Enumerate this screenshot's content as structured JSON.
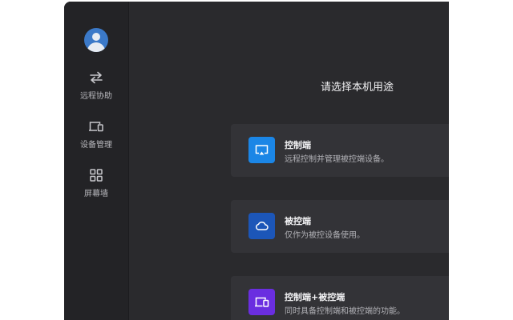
{
  "sidebar": {
    "items": [
      {
        "label": "远程协助",
        "icon": "swap-arrows-icon"
      },
      {
        "label": "设备管理",
        "icon": "devices-icon"
      },
      {
        "label": "屏幕墙",
        "icon": "grid-icon"
      }
    ]
  },
  "main": {
    "title": "请选择本机用途",
    "cards": [
      {
        "title": "控制端",
        "desc": "远程控制并管理被控端设备。",
        "icon": "cast-screen-icon",
        "icon_color": "#1b86e6"
      },
      {
        "title": "被控端",
        "desc": "仅作为被控设备使用。",
        "icon": "cloud-icon",
        "icon_color": "#1c56b8"
      },
      {
        "title": "控制端+被控端",
        "desc": "同时具备控制端和被控端的功能。",
        "icon": "devices-icon",
        "icon_color": "#6a2ee0"
      }
    ]
  },
  "colors": {
    "window_bg": "#2a2a2d",
    "sidebar_bg": "#232326",
    "card_bg": "#333337",
    "avatar": "#3b79c8"
  }
}
